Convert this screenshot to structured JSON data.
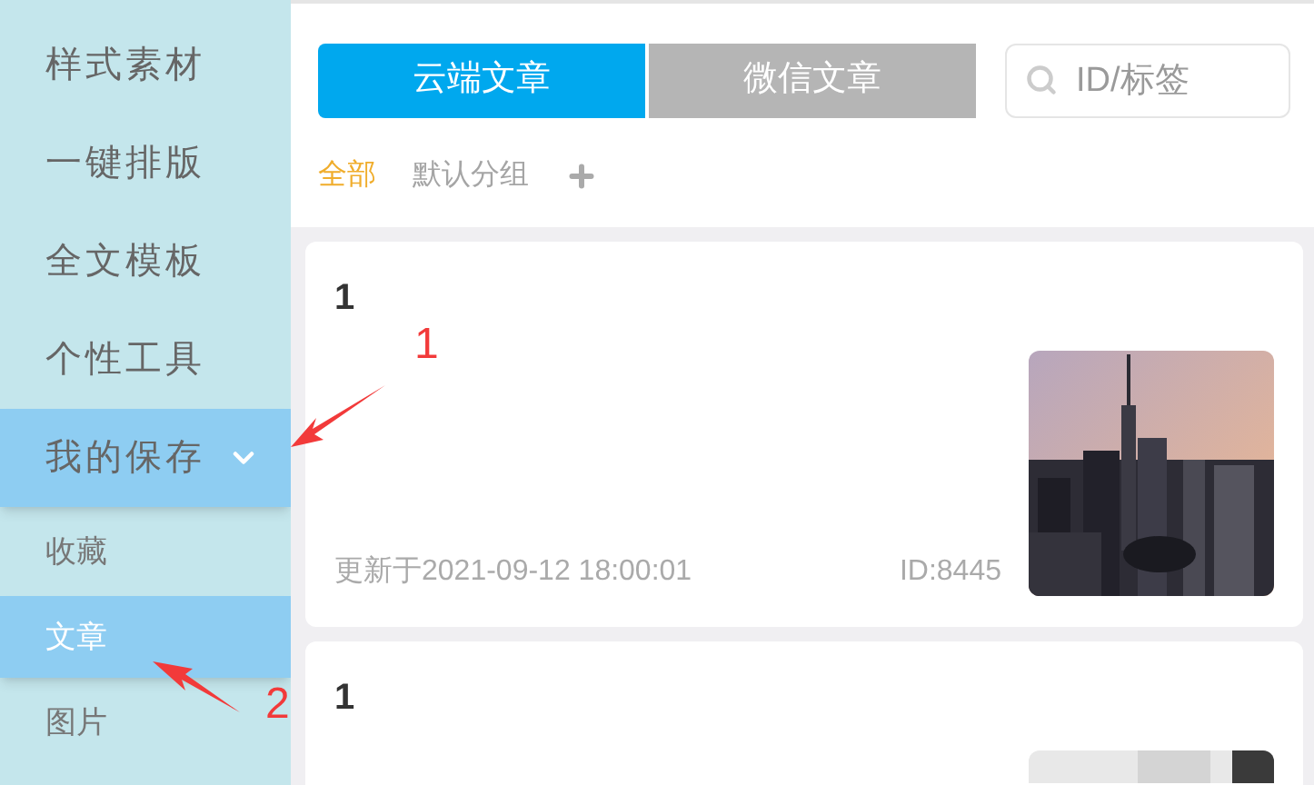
{
  "sidebar": {
    "items": [
      {
        "label": "样式素材",
        "selected": false
      },
      {
        "label": "一键排版",
        "selected": false
      },
      {
        "label": "全文模板",
        "selected": false
      },
      {
        "label": "个性工具",
        "selected": false
      },
      {
        "label": "我的保存",
        "selected": true,
        "expanded": true,
        "children": [
          {
            "label": "收藏",
            "selected": false
          },
          {
            "label": "文章",
            "selected": true
          },
          {
            "label": "图片",
            "selected": false
          }
        ]
      }
    ]
  },
  "tabs": [
    {
      "label": "云端文章",
      "selected": true
    },
    {
      "label": "微信文章",
      "selected": false
    }
  ],
  "search": {
    "placeholder": "ID/标签"
  },
  "groups": [
    {
      "label": "全部",
      "selected": true
    },
    {
      "label": "默认分组",
      "selected": false
    }
  ],
  "articles": [
    {
      "title": "1",
      "updated": "更新于2021-09-12 18:00:01",
      "id": "ID:8445"
    },
    {
      "title": "1"
    }
  ],
  "annotations": [
    {
      "label": "1"
    },
    {
      "label": "2"
    }
  ]
}
